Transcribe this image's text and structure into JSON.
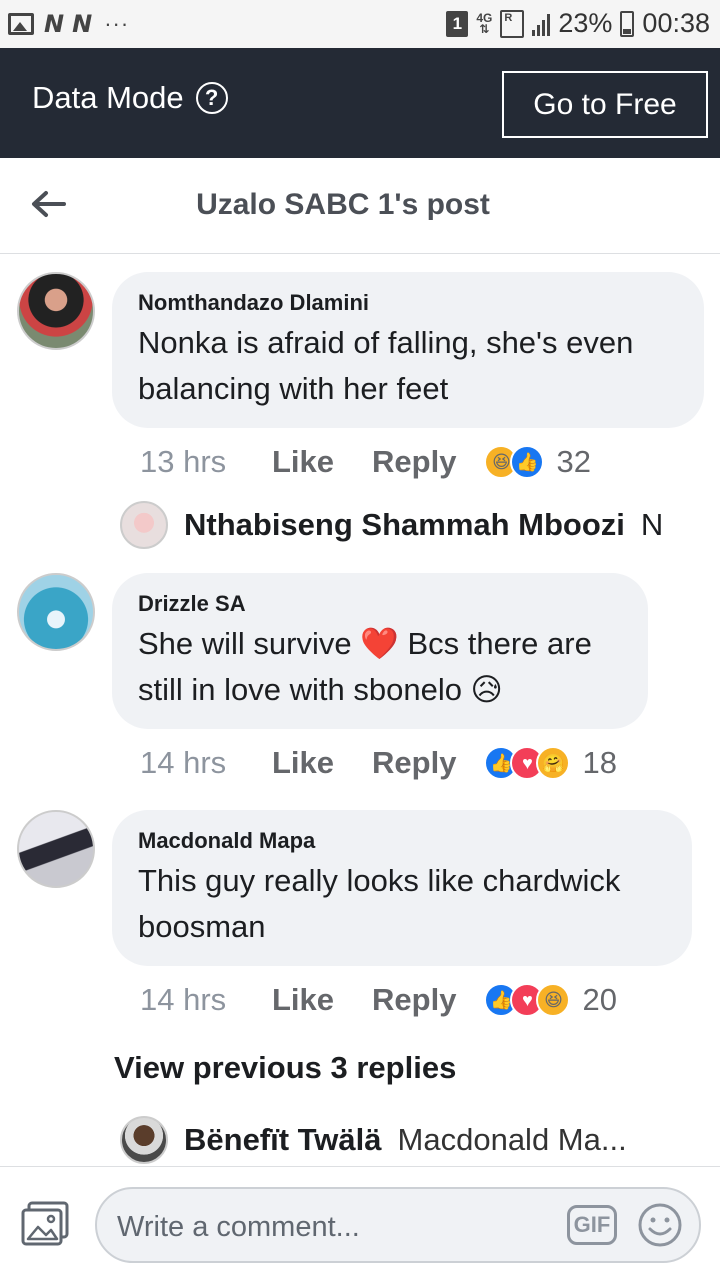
{
  "status_bar": {
    "badge": "1",
    "network": "4G",
    "sim": "R",
    "battery": "23%",
    "time": "00:38"
  },
  "data_bar": {
    "label": "Data Mode",
    "help": "?",
    "button": "Go to Free"
  },
  "header": {
    "title": "Uzalo SABC 1's post"
  },
  "comments": [
    {
      "author": "Nomthandazo Dlamini",
      "text": "Nonka is afraid of falling, she's even balancing with her feet",
      "time": "13 hrs",
      "like": "Like",
      "reply": "Reply",
      "reactions": [
        "haha",
        "like"
      ],
      "reaction_count": "32"
    },
    {
      "author": "Drizzle SA",
      "text": "She will survive ❤️ Bcs there are still in love with sbonelo 😥",
      "time": "14 hrs",
      "like": "Like",
      "reply": "Reply",
      "reactions": [
        "like",
        "love",
        "care"
      ],
      "reaction_count": "18"
    },
    {
      "author": "Macdonald Mapa",
      "text": "This guy really looks like chardwick boosman",
      "time": "14 hrs",
      "like": "Like",
      "reply": "Reply",
      "reactions": [
        "like",
        "love",
        "haha"
      ],
      "reaction_count": "20"
    }
  ],
  "replies": [
    {
      "name": "Nthabiseng Shammah Mboozi",
      "text": "N"
    },
    {
      "name": "Bënefït Twälä",
      "text": "Macdonald Ma..."
    }
  ],
  "view_previous": "View previous 3 replies",
  "composer": {
    "placeholder": "Write a comment...",
    "gif": "GIF"
  },
  "colors": {
    "data_bar": "#242a35",
    "bubble": "#f0f2f5",
    "like_blue": "#1877f2",
    "love_red": "#f33e58",
    "haha_yellow": "#f7b125"
  }
}
